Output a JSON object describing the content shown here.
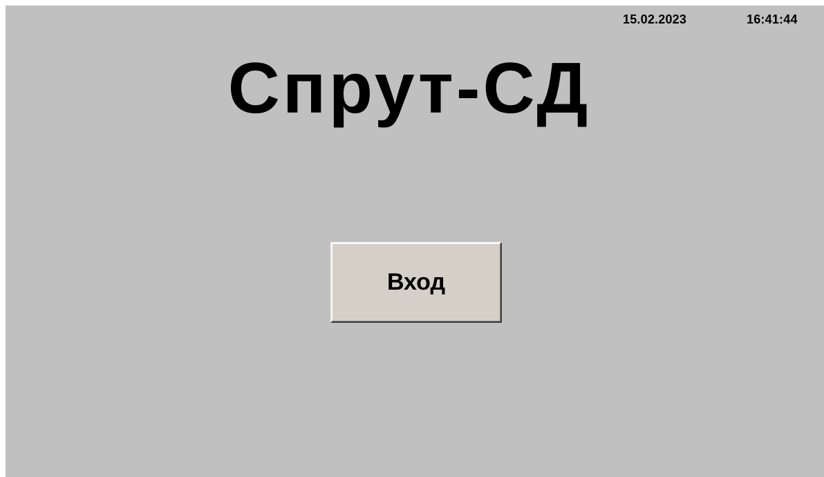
{
  "header": {
    "date": "15.02.2023",
    "time": "16:41:44"
  },
  "main": {
    "title": "Спрут-СД",
    "login_button_label": "Вход"
  },
  "colors": {
    "background": "#c0c0c0",
    "button_face": "#d4d0c8",
    "text": "#000000"
  }
}
